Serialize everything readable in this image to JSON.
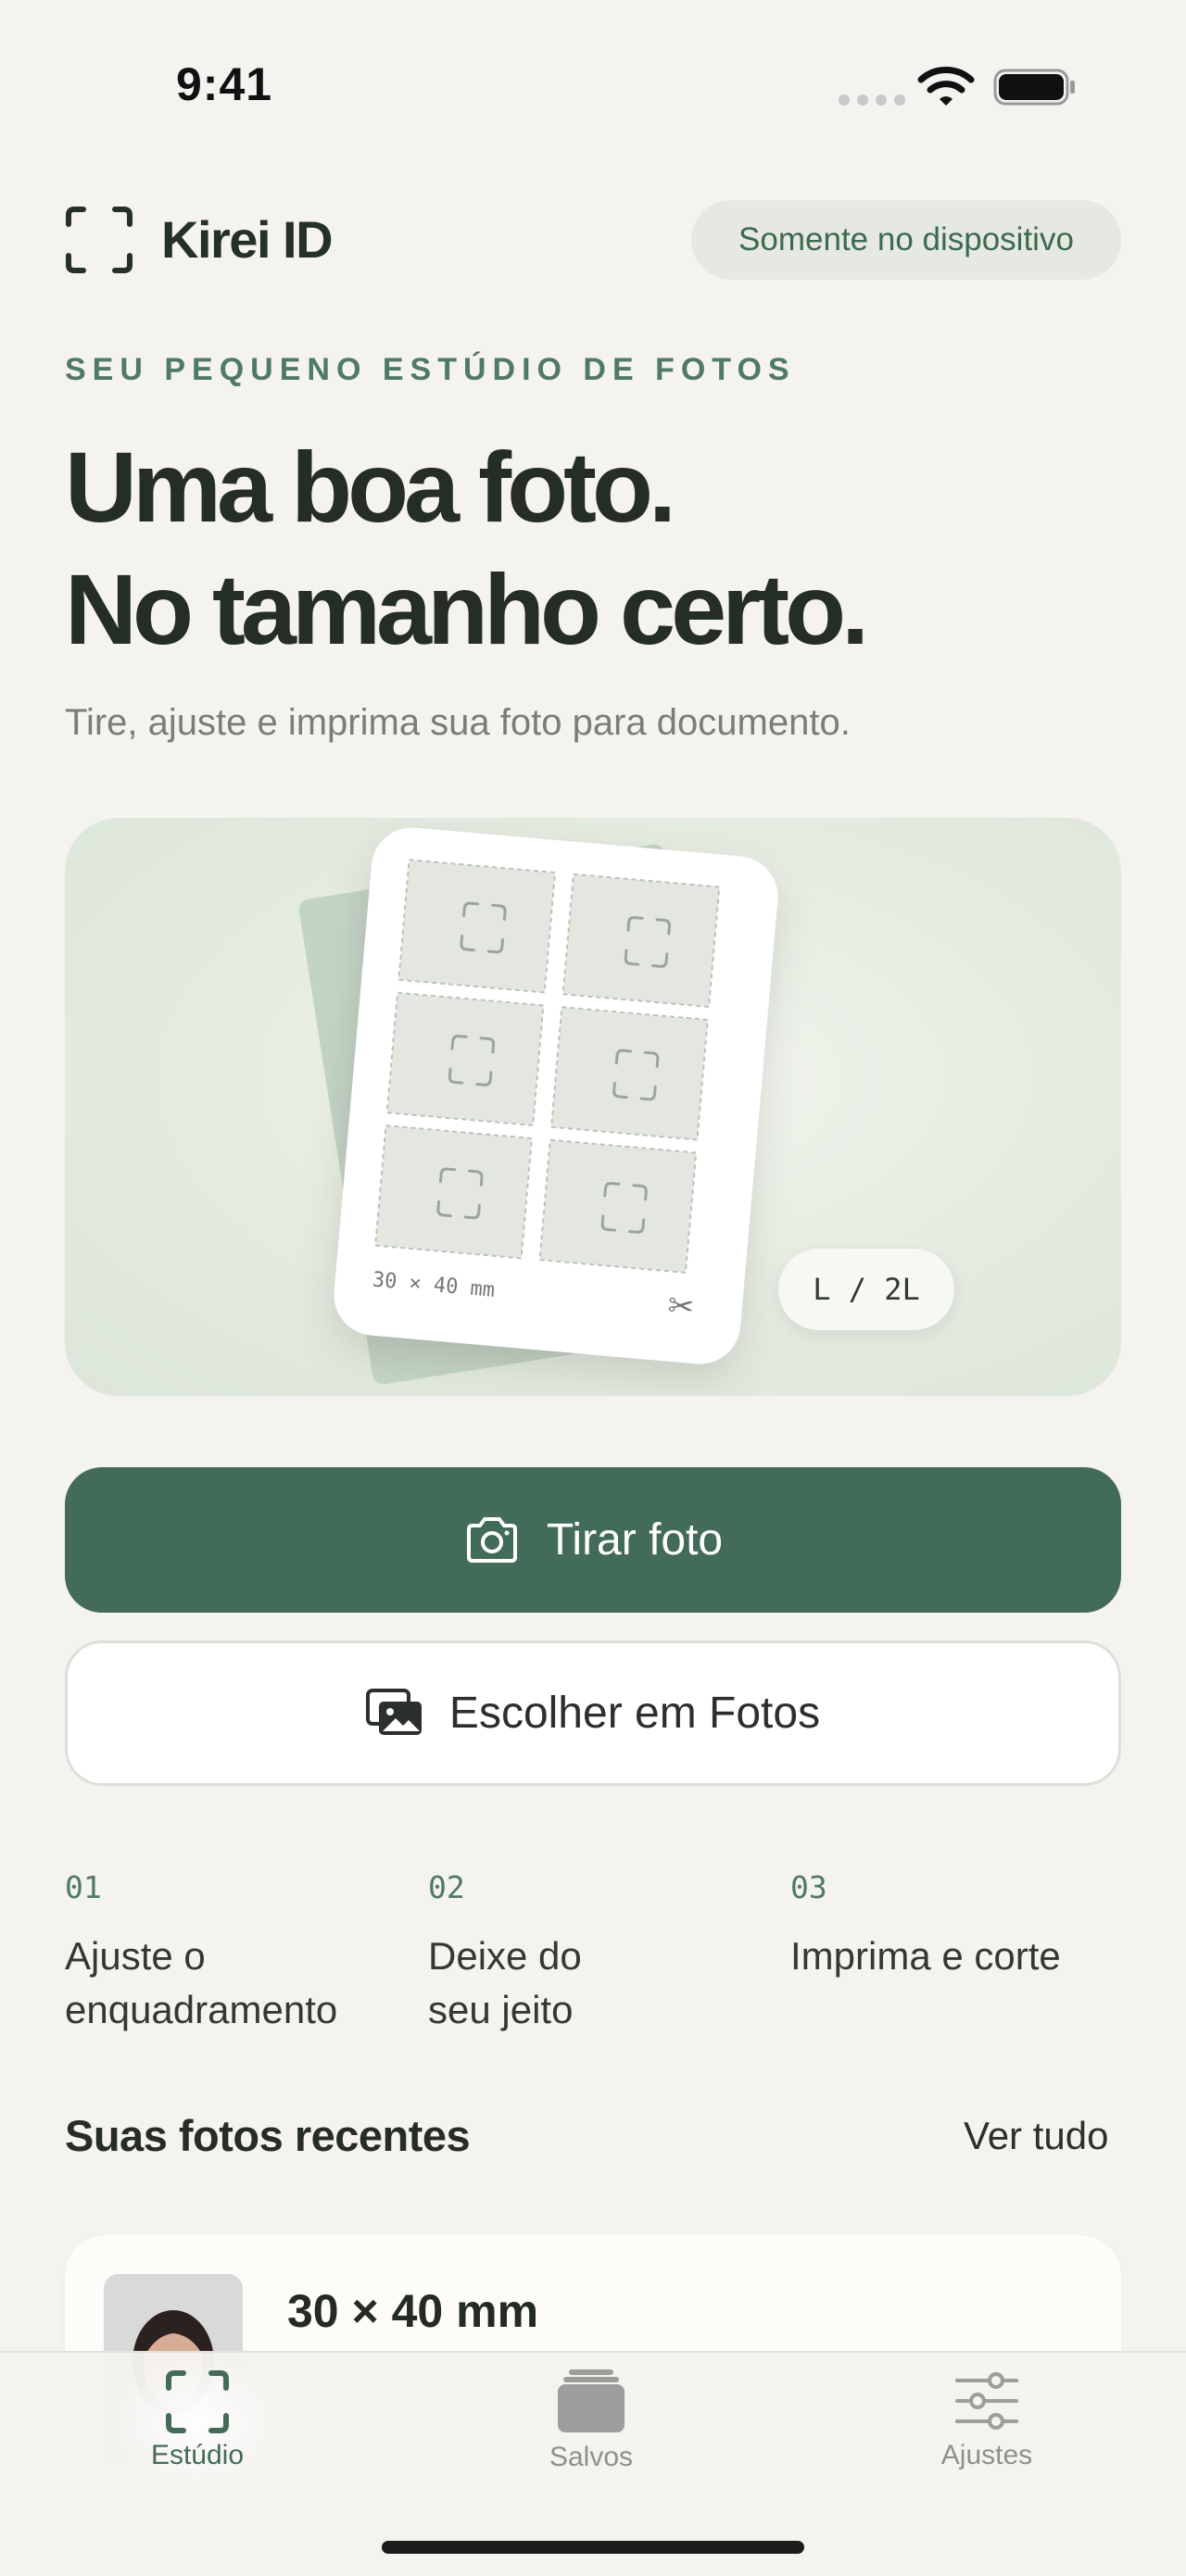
{
  "status_bar": {
    "time": "9:41"
  },
  "header": {
    "app_name": "Kirei ID",
    "device_badge": "Somente no dispositivo"
  },
  "hero": {
    "eyebrow": "SEU PEQUENO ESTÚDIO DE FOTOS",
    "headline_line1": "Uma boa foto.",
    "headline_line2": "No tamanho certo.",
    "subtitle": "Tire, ajuste e imprima sua foto para documento.",
    "sheet_size_label": "30 × 40 mm",
    "paper_size_label": "L / 2L"
  },
  "actions": {
    "take_photo": "Tirar foto",
    "choose_photos": "Escolher em Fotos"
  },
  "steps": [
    {
      "number": "01",
      "line1": "Ajuste o",
      "line2": "enquadramento"
    },
    {
      "number": "02",
      "line1": "Deixe do",
      "line2": "seu jeito"
    },
    {
      "number": "03",
      "line1": "Imprima e corte",
      "line2": ""
    }
  ],
  "recent": {
    "title": "Suas fotos recentes",
    "see_all": "Ver tudo",
    "items": [
      {
        "size": "30 × 40 mm"
      }
    ]
  },
  "tabbar": {
    "tabs": [
      {
        "label": "Estúdio",
        "icon": "frame-icon",
        "active": true
      },
      {
        "label": "Salvos",
        "icon": "stack-icon",
        "active": false
      },
      {
        "label": "Ajustes",
        "icon": "sliders-icon",
        "active": false
      }
    ]
  },
  "colors": {
    "accent": "#436b59",
    "background": "#f5f3ef",
    "eyebrow": "#4f7a63"
  }
}
